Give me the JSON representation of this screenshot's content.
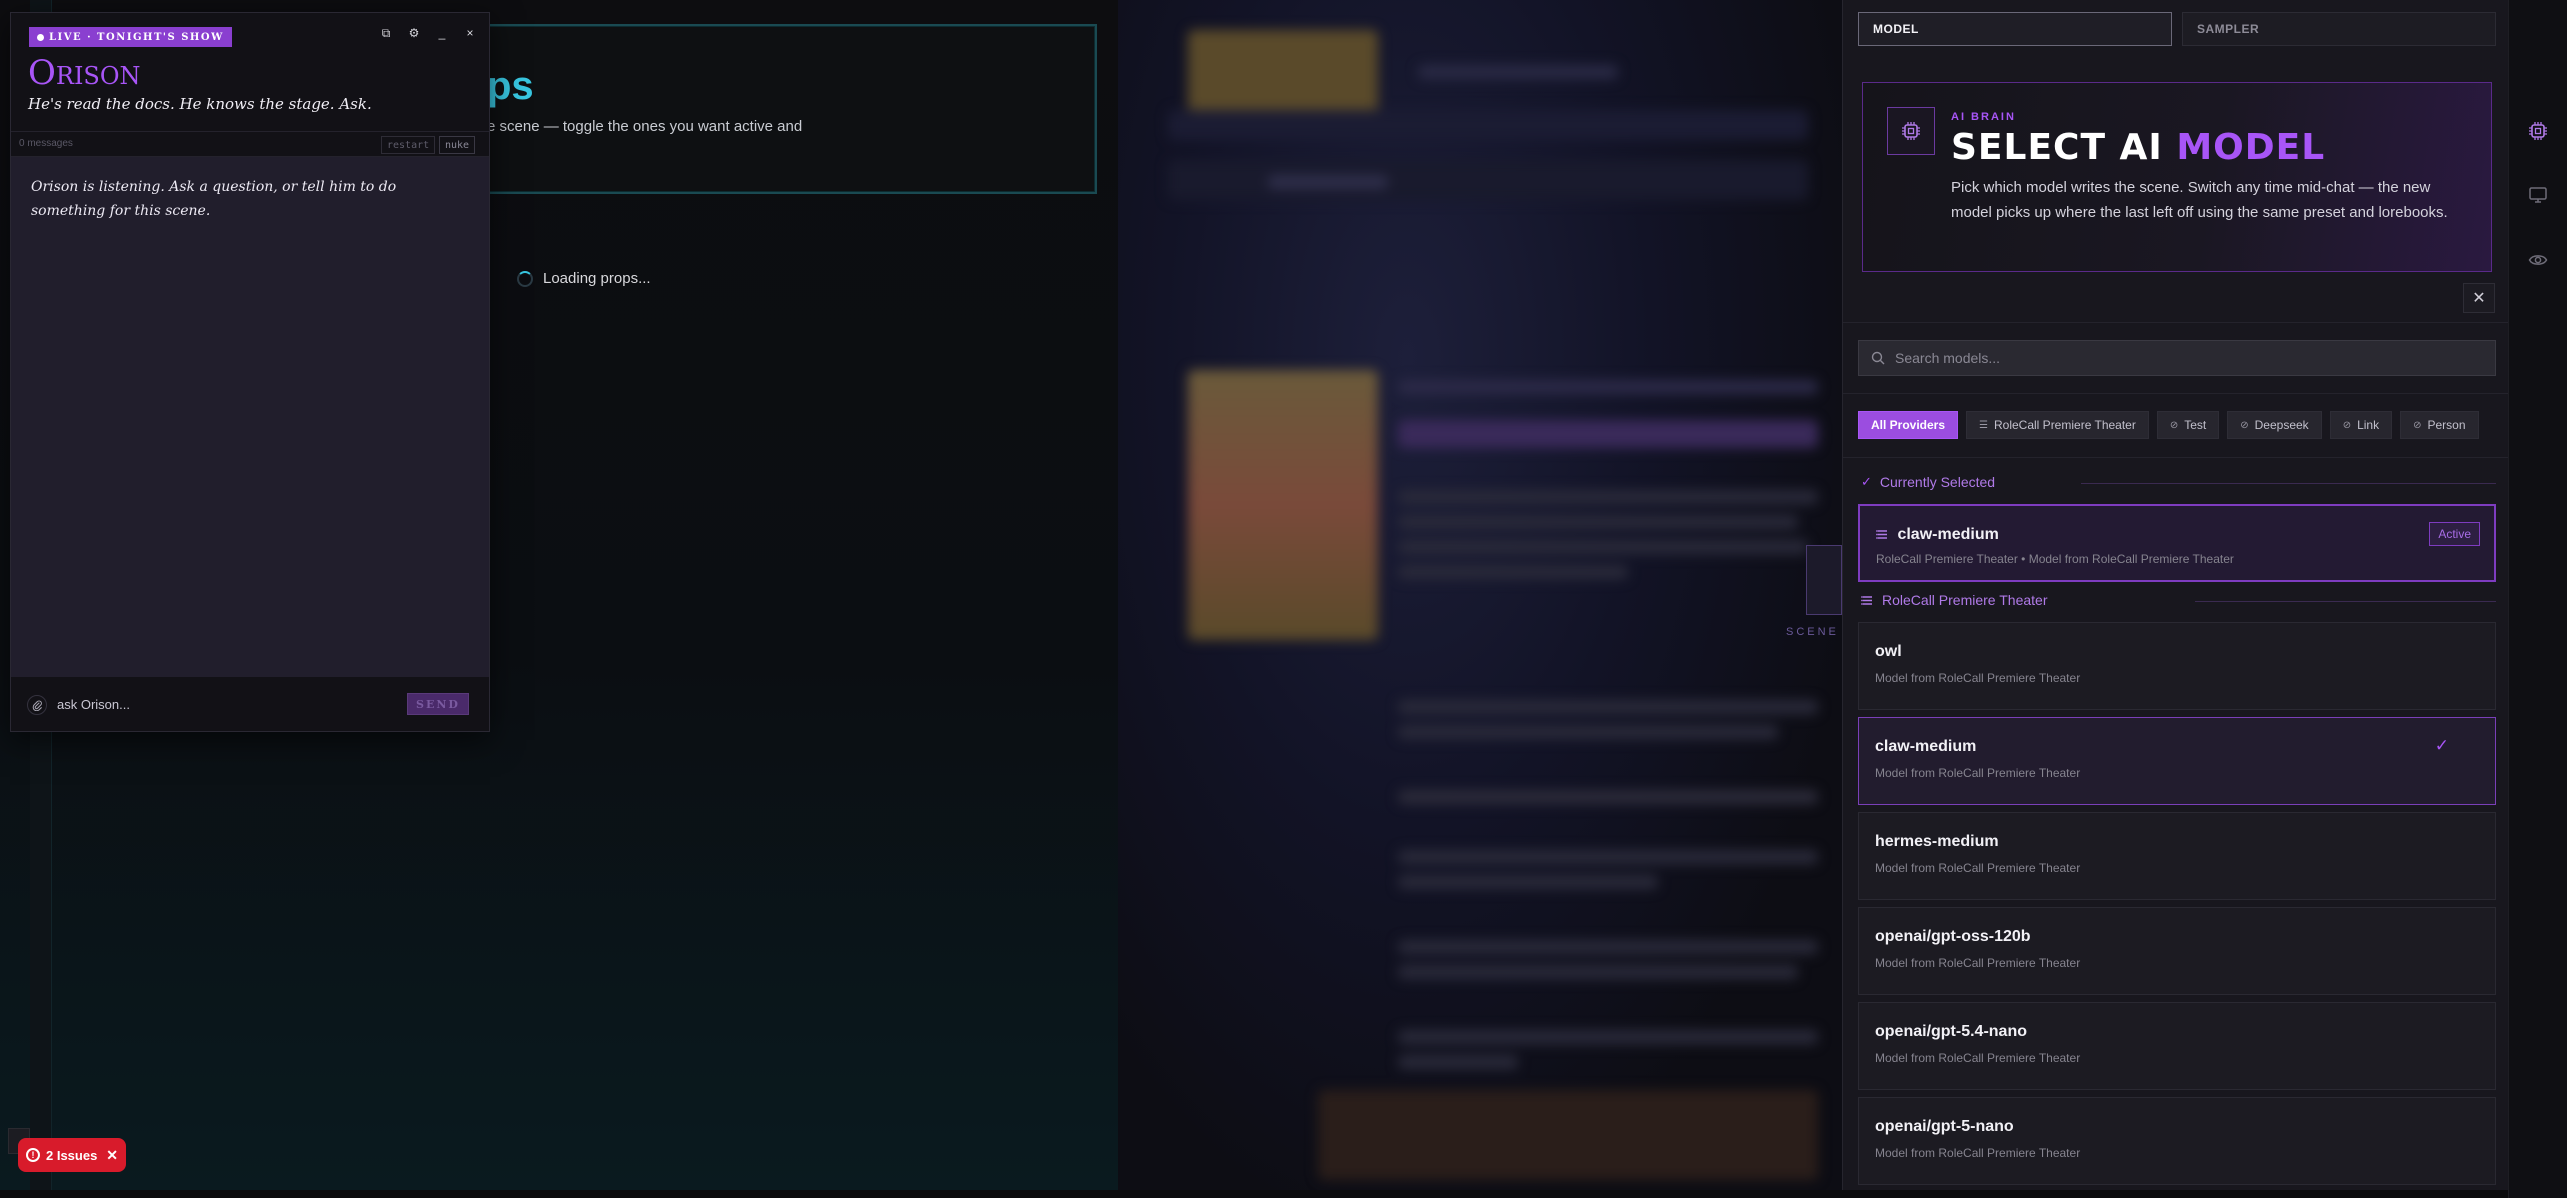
{
  "background": {
    "props_title": "ps",
    "props_subtitle": "e scene — toggle the ones you want active and",
    "loading_text": "Loading props...",
    "scene_label": "SCENE"
  },
  "orison": {
    "live_badge": "LIVE · TONIGHT'S SHOW",
    "controls": [
      "⧉",
      "⚙",
      "_",
      "×"
    ],
    "name": "Orison",
    "tagline": "He's read the docs. He knows the stage. Ask.",
    "message_count": "0 messages",
    "restart_label": "restart",
    "nuke_label": "nuke",
    "intro": "Orison is listening. Ask a question, or tell him to do something for this scene.",
    "input_placeholder": "ask Orison...",
    "send_label": "SEND"
  },
  "issues": {
    "label": "2 Issues",
    "color": "#d81b2b"
  },
  "panel": {
    "tabs": [
      {
        "label": "MODEL",
        "active": true
      },
      {
        "label": "SAMPLER",
        "active": false
      }
    ],
    "hero": {
      "icon": "chip-icon",
      "eyebrow": "AI BRAIN",
      "title_main": "SELECT AI ",
      "title_accent": "MODEL",
      "body": "Pick which model writes the scene. Switch any time mid-chat — the new model picks up where the last left off using the same preset and lorebooks."
    },
    "close_label": "✕",
    "search_placeholder": "Search models...",
    "chips": [
      {
        "label": "All Providers",
        "active": true,
        "icon": ""
      },
      {
        "label": "RoleCall Premiere Theater",
        "active": false,
        "icon": "list-icon"
      },
      {
        "label": "Test",
        "active": false,
        "icon": "key-icon"
      },
      {
        "label": "Deepseek",
        "active": false,
        "icon": "key-icon"
      },
      {
        "label": "Link",
        "active": false,
        "icon": "key-icon"
      },
      {
        "label": "Person",
        "active": false,
        "icon": "key-icon"
      }
    ],
    "currently_selected_label": "Currently Selected",
    "current": {
      "name": "claw-medium",
      "sub": "RoleCall Premiere Theater • Model from RoleCall Premiere Theater",
      "badge": "Active"
    },
    "group_label": "RoleCall Premiere Theater",
    "models": [
      {
        "name": "owl",
        "sub": "Model from RoleCall Premiere Theater",
        "selected": false
      },
      {
        "name": "claw-medium",
        "sub": "Model from RoleCall Premiere Theater",
        "selected": true
      },
      {
        "name": "hermes-medium",
        "sub": "Model from RoleCall Premiere Theater",
        "selected": false
      },
      {
        "name": "openai/gpt-oss-120b",
        "sub": "Model from RoleCall Premiere Theater",
        "selected": false
      },
      {
        "name": "openai/gpt-5.4-nano",
        "sub": "Model from RoleCall Premiere Theater",
        "selected": false
      },
      {
        "name": "openai/gpt-5-nano",
        "sub": "Model from RoleCall Premiere Theater",
        "selected": false
      }
    ],
    "accent": "#a855f7"
  },
  "rail": {
    "icons": [
      "chip-icon",
      "monitor-icon",
      "eye-icon"
    ]
  }
}
